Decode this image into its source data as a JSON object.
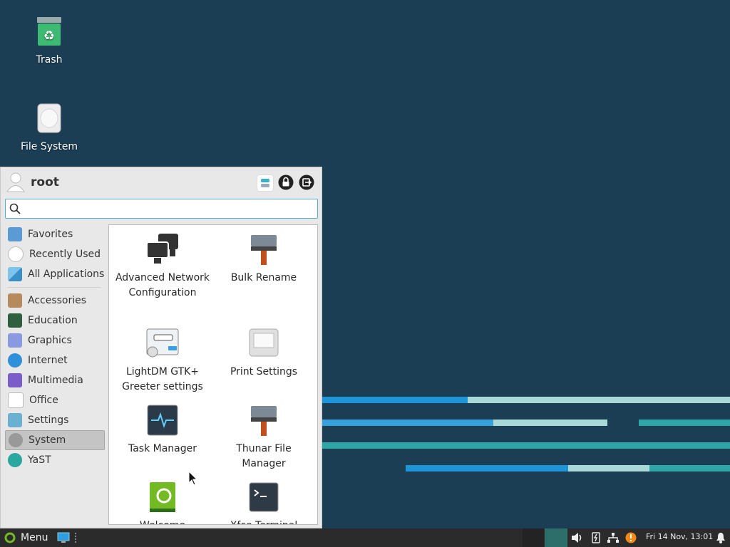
{
  "desktop": {
    "icons": [
      {
        "label": "Trash"
      },
      {
        "label": "File System"
      }
    ]
  },
  "menu": {
    "user": "root",
    "search": {
      "value": "",
      "placeholder": ""
    },
    "categories": [
      {
        "label": "Favorites"
      },
      {
        "label": "Recently Used"
      },
      {
        "label": "All Applications"
      },
      {
        "label": "Accessories"
      },
      {
        "label": "Education"
      },
      {
        "label": "Graphics"
      },
      {
        "label": "Internet"
      },
      {
        "label": "Multimedia"
      },
      {
        "label": "Office"
      },
      {
        "label": "Settings"
      },
      {
        "label": "System",
        "selected": true
      },
      {
        "label": "YaST"
      }
    ],
    "apps": [
      {
        "label": "Advanced Network Configuration",
        "icon": "network-icon"
      },
      {
        "label": "Bulk Rename",
        "icon": "bulk-rename-icon"
      },
      {
        "label": "LightDM GTK+ Greeter settings",
        "icon": "lightdm-icon"
      },
      {
        "label": "Print Settings",
        "icon": "printer-icon"
      },
      {
        "label": "Task Manager",
        "icon": "task-manager-icon"
      },
      {
        "label": "Thunar File Manager",
        "icon": "thunar-icon"
      },
      {
        "label": "Welcome",
        "icon": "welcome-icon"
      },
      {
        "label": "Xfce Terminal",
        "icon": "terminal-icon"
      }
    ]
  },
  "taskbar": {
    "menu_label": "Menu",
    "clock": "Fri 14 Nov, 13:01"
  },
  "colors": {
    "desktop": "#1c3e55",
    "accent": "#4eb0c8",
    "suse_green": "#73ba25"
  }
}
